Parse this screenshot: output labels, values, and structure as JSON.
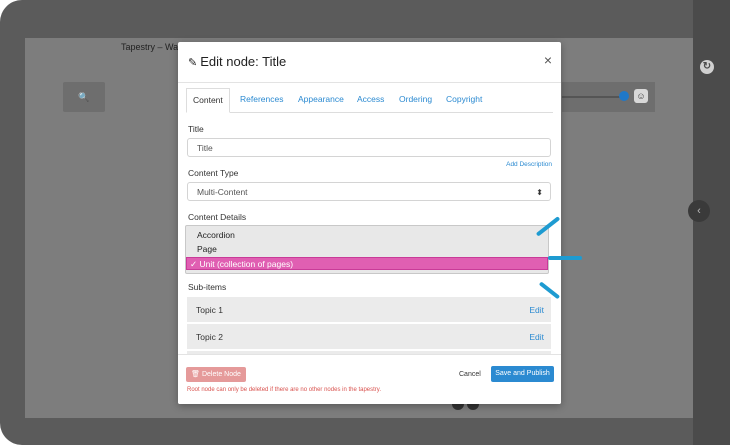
{
  "background": {
    "page_title": "Tapestry – Wall",
    "search_icon": "search-icon",
    "right_icon": "refresh-icon",
    "collapse_icon": "chevron-left-icon",
    "slider_level": 0.63
  },
  "modal": {
    "title": "Edit node: Title",
    "title_icon": "pencil-icon",
    "close": "×",
    "tabs": [
      "Content",
      "References",
      "Appearance",
      "Access",
      "Ordering",
      "Copyright"
    ],
    "active_tab": "Content",
    "title_label": "Title",
    "title_value": "Title",
    "add_description": "Add Description",
    "content_type_label": "Content Type",
    "content_type_value": "Multi-Content",
    "content_details_label": "Content Details",
    "dropdown_options": [
      "Accordion",
      "Page",
      "✓ Unit (collection of pages)"
    ],
    "selected_option_index": 2,
    "subitems_label": "Sub-items",
    "subitems": [
      {
        "name": "Topic 1",
        "action": "Edit"
      },
      {
        "name": "Topic 2",
        "action": "Edit"
      }
    ],
    "footer": {
      "delete_label": "Delete Node",
      "warning": "Root node can only be deleted if there are no other nodes in the tapestry.",
      "cancel_label": "Cancel",
      "save_label": "Save and Publish"
    }
  },
  "colors": {
    "accent_blue": "#2b8ad1",
    "selected_pink": "#e05fb2",
    "delete_red": "#e59a9a",
    "marker_blue": "#1e9bd1"
  }
}
